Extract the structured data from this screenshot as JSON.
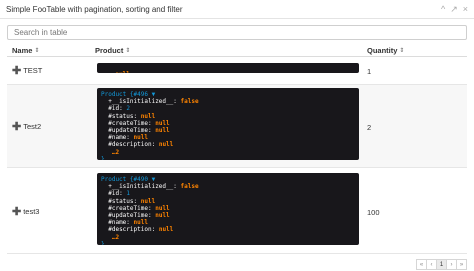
{
  "window": {
    "title": "Simple FooTable with pagination, sorting and filter",
    "controls": [
      "^",
      "↗",
      "×"
    ]
  },
  "search": {
    "placeholder": "Search in table",
    "value": ""
  },
  "table": {
    "columns": [
      {
        "label": "Name",
        "sort": "⇕"
      },
      {
        "label": "Product",
        "sort": "⇕"
      },
      {
        "label": "Quantity",
        "sort": "⇕"
      }
    ],
    "rows": [
      {
        "expand": "✚",
        "name": "TEST",
        "product": "null",
        "quantity": "1"
      },
      {
        "expand": "✚",
        "name": "Test2",
        "quantity": "2",
        "product_dump": {
          "header": "Product {#496 ▼",
          "lines": [
            [
              "+__isInitialized__:",
              "false"
            ],
            [
              "#id:",
              "2"
            ],
            [
              "#status:",
              "null"
            ],
            [
              "#createTime:",
              "null"
            ],
            [
              "#updateTime:",
              "null"
            ],
            [
              "#name:",
              "null"
            ],
            [
              "#description:",
              "null"
            ],
            [
              "…2",
              ""
            ]
          ],
          "footer": "}"
        }
      },
      {
        "expand": "✚",
        "name": "test3",
        "quantity": "100",
        "product_dump": {
          "header": "Product {#490 ▼",
          "lines": [
            [
              "+__isInitialized__:",
              "false"
            ],
            [
              "#id:",
              "1"
            ],
            [
              "#status:",
              "null"
            ],
            [
              "#createTime:",
              "null"
            ],
            [
              "#updateTime:",
              "null"
            ],
            [
              "#name:",
              "null"
            ],
            [
              "#description:",
              "null"
            ],
            [
              "…2",
              ""
            ]
          ],
          "footer": "}"
        }
      }
    ]
  },
  "pagination": {
    "first": "«",
    "prev": "‹",
    "current": "1",
    "next": "›",
    "last": "»"
  }
}
